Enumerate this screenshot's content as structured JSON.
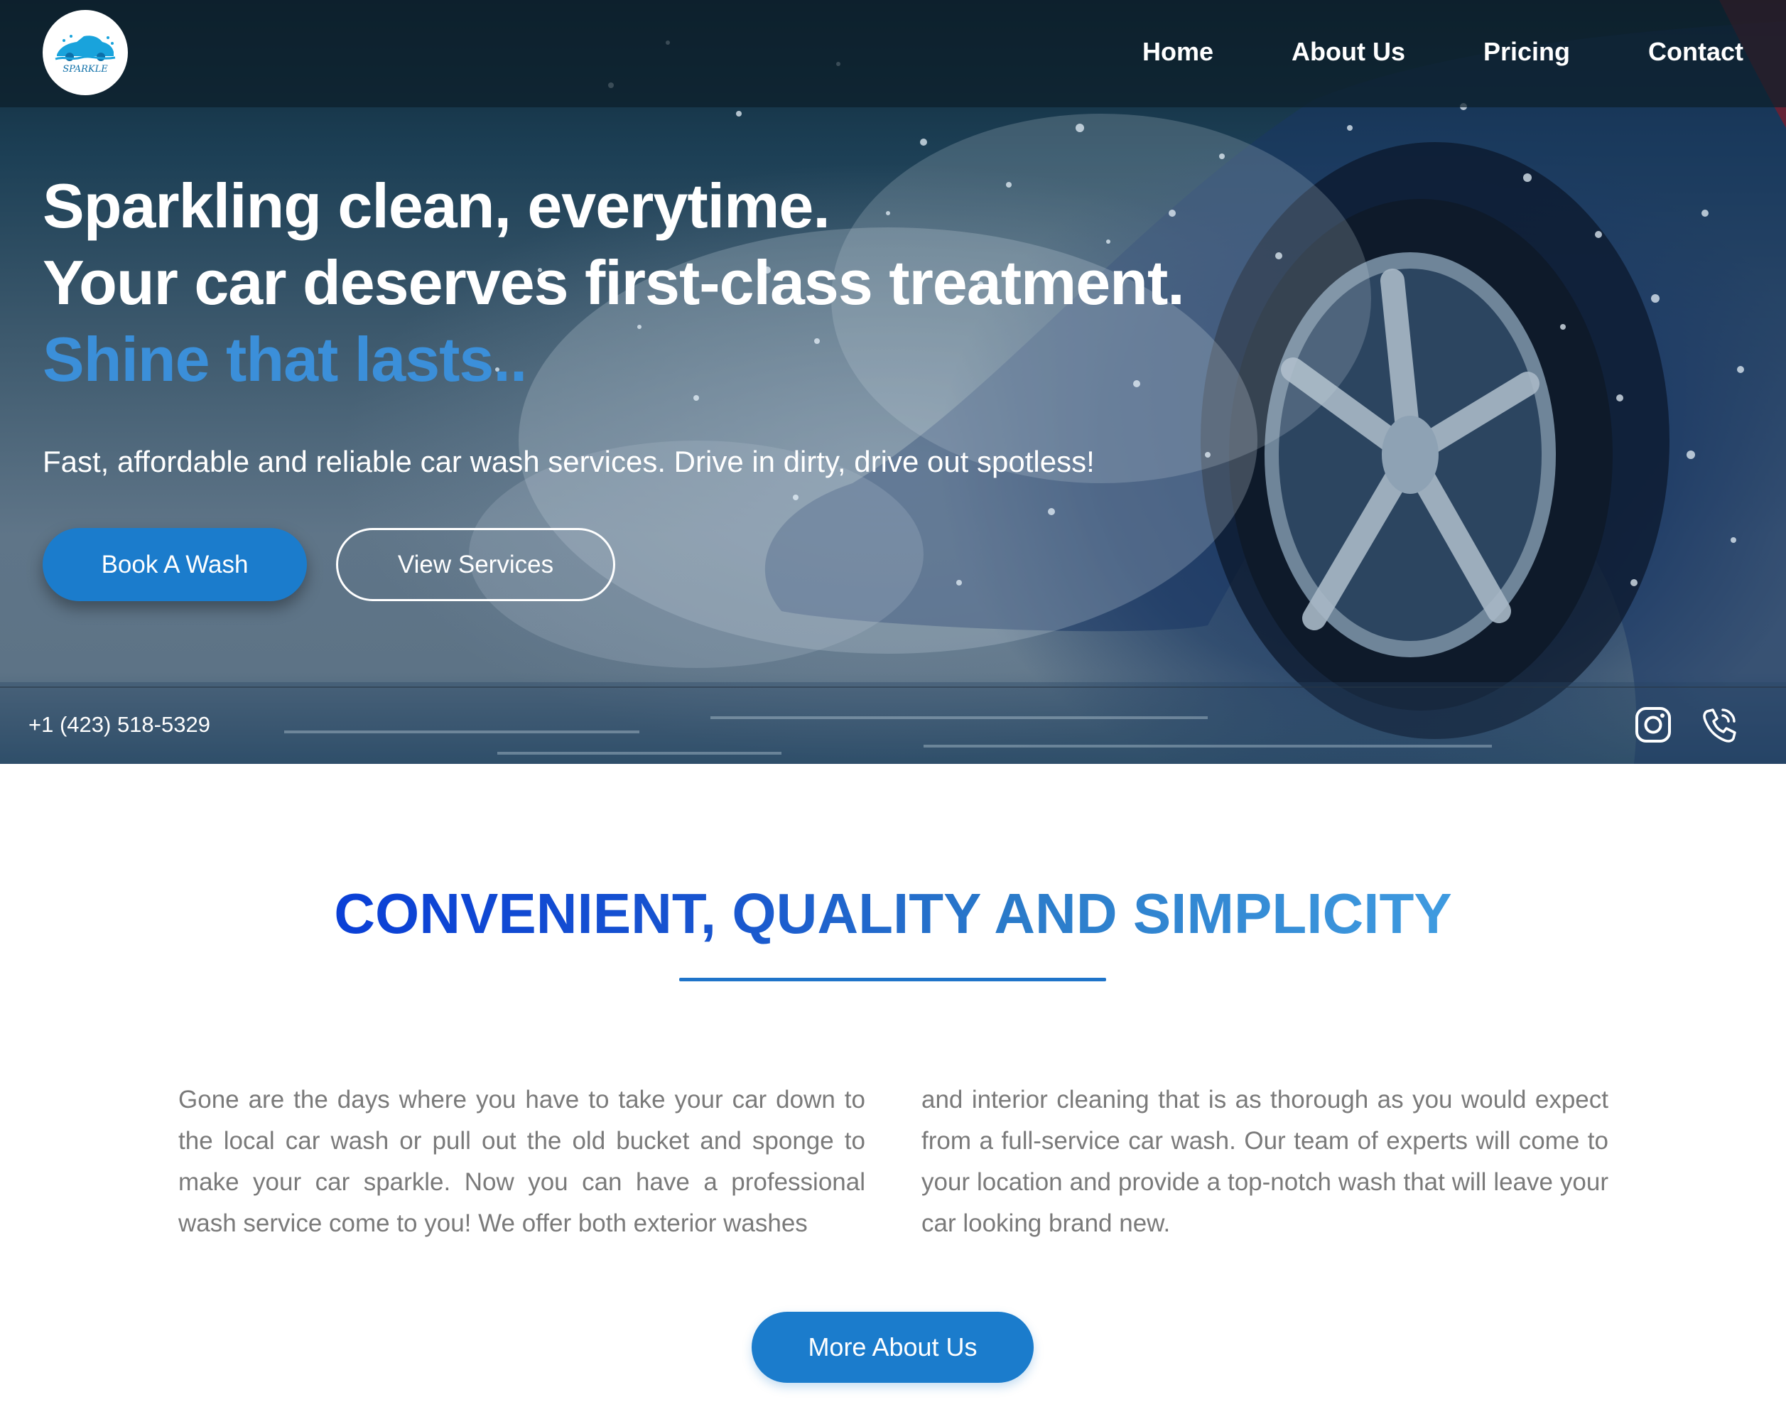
{
  "brand": {
    "logo_text": "SPARKLE"
  },
  "nav": {
    "items": [
      "Home",
      "About Us",
      "Pricing",
      "Contact"
    ]
  },
  "hero": {
    "headline_line1": "Sparkling clean, everytime.",
    "headline_line2": "Your car deserves first-class treatment.",
    "headline_accent": "Shine that lasts..",
    "tagline": "Fast, affordable and reliable car wash services. Drive in dirty, drive out spotless!",
    "primary_button": "Book A Wash",
    "secondary_button": "View Services",
    "phone": "+1 (423) 518-5329",
    "social_icons": [
      "instagram-icon",
      "phone-icon"
    ]
  },
  "about": {
    "title": "CONVENIENT, QUALITY AND SIMPLICITY",
    "paragraph_left": "Gone are the days where you have to take your car down to the local car wash or pull out the old bucket and sponge to make your car sparkle. Now you can have a professional wash service come to you! We offer both exterior washes",
    "paragraph_right": "and interior cleaning that is as thorough as you would expect from a full-service car wash. Our team of experts will come to your location and provide a top-notch wash that will leave your car looking brand new.",
    "button": "More About Us"
  },
  "colors": {
    "accent_blue": "#1b7ccc",
    "headline_accent": "#3b8fd9",
    "title_gradient_start": "#0a3fd6",
    "title_gradient_end": "#3f9be0",
    "body_text": "#7a7a7a"
  }
}
